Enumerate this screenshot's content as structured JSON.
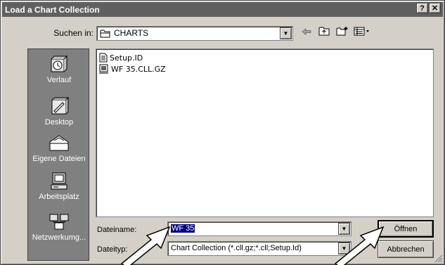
{
  "window": {
    "title": "Load a Chart Collection",
    "help_glyph": "?",
    "close_glyph": "✕"
  },
  "lookin": {
    "label": "Suchen in:",
    "value": "CHARTS"
  },
  "toolbar": {
    "back_icon": "back-arrow-icon",
    "up_icon": "up-folder-icon",
    "newfolder_icon": "new-folder-icon",
    "view_icon": "view-menu-icon"
  },
  "places": [
    {
      "label": "Verlauf",
      "icon": "history-icon"
    },
    {
      "label": "Desktop",
      "icon": "desktop-icon"
    },
    {
      "label": "Eigene Dateien",
      "icon": "my-documents-icon"
    },
    {
      "label": "Arbeitsplatz",
      "icon": "my-computer-icon"
    },
    {
      "label": "Netzwerkumg...",
      "icon": "network-icon"
    }
  ],
  "files": [
    {
      "name": "Setup.ID",
      "icon": "text-file-icon"
    },
    {
      "name": "WF 35.CLL.GZ",
      "icon": "chart-file-icon"
    }
  ],
  "filename": {
    "label": "Dateiname:",
    "value": "WF 35"
  },
  "filetype": {
    "label": "Dateityp:",
    "value": "Chart Collection (*.cll.gz;*.cll;Setup.Id)"
  },
  "buttons": {
    "open": "Öffnen",
    "cancel": "Abbrechen"
  }
}
